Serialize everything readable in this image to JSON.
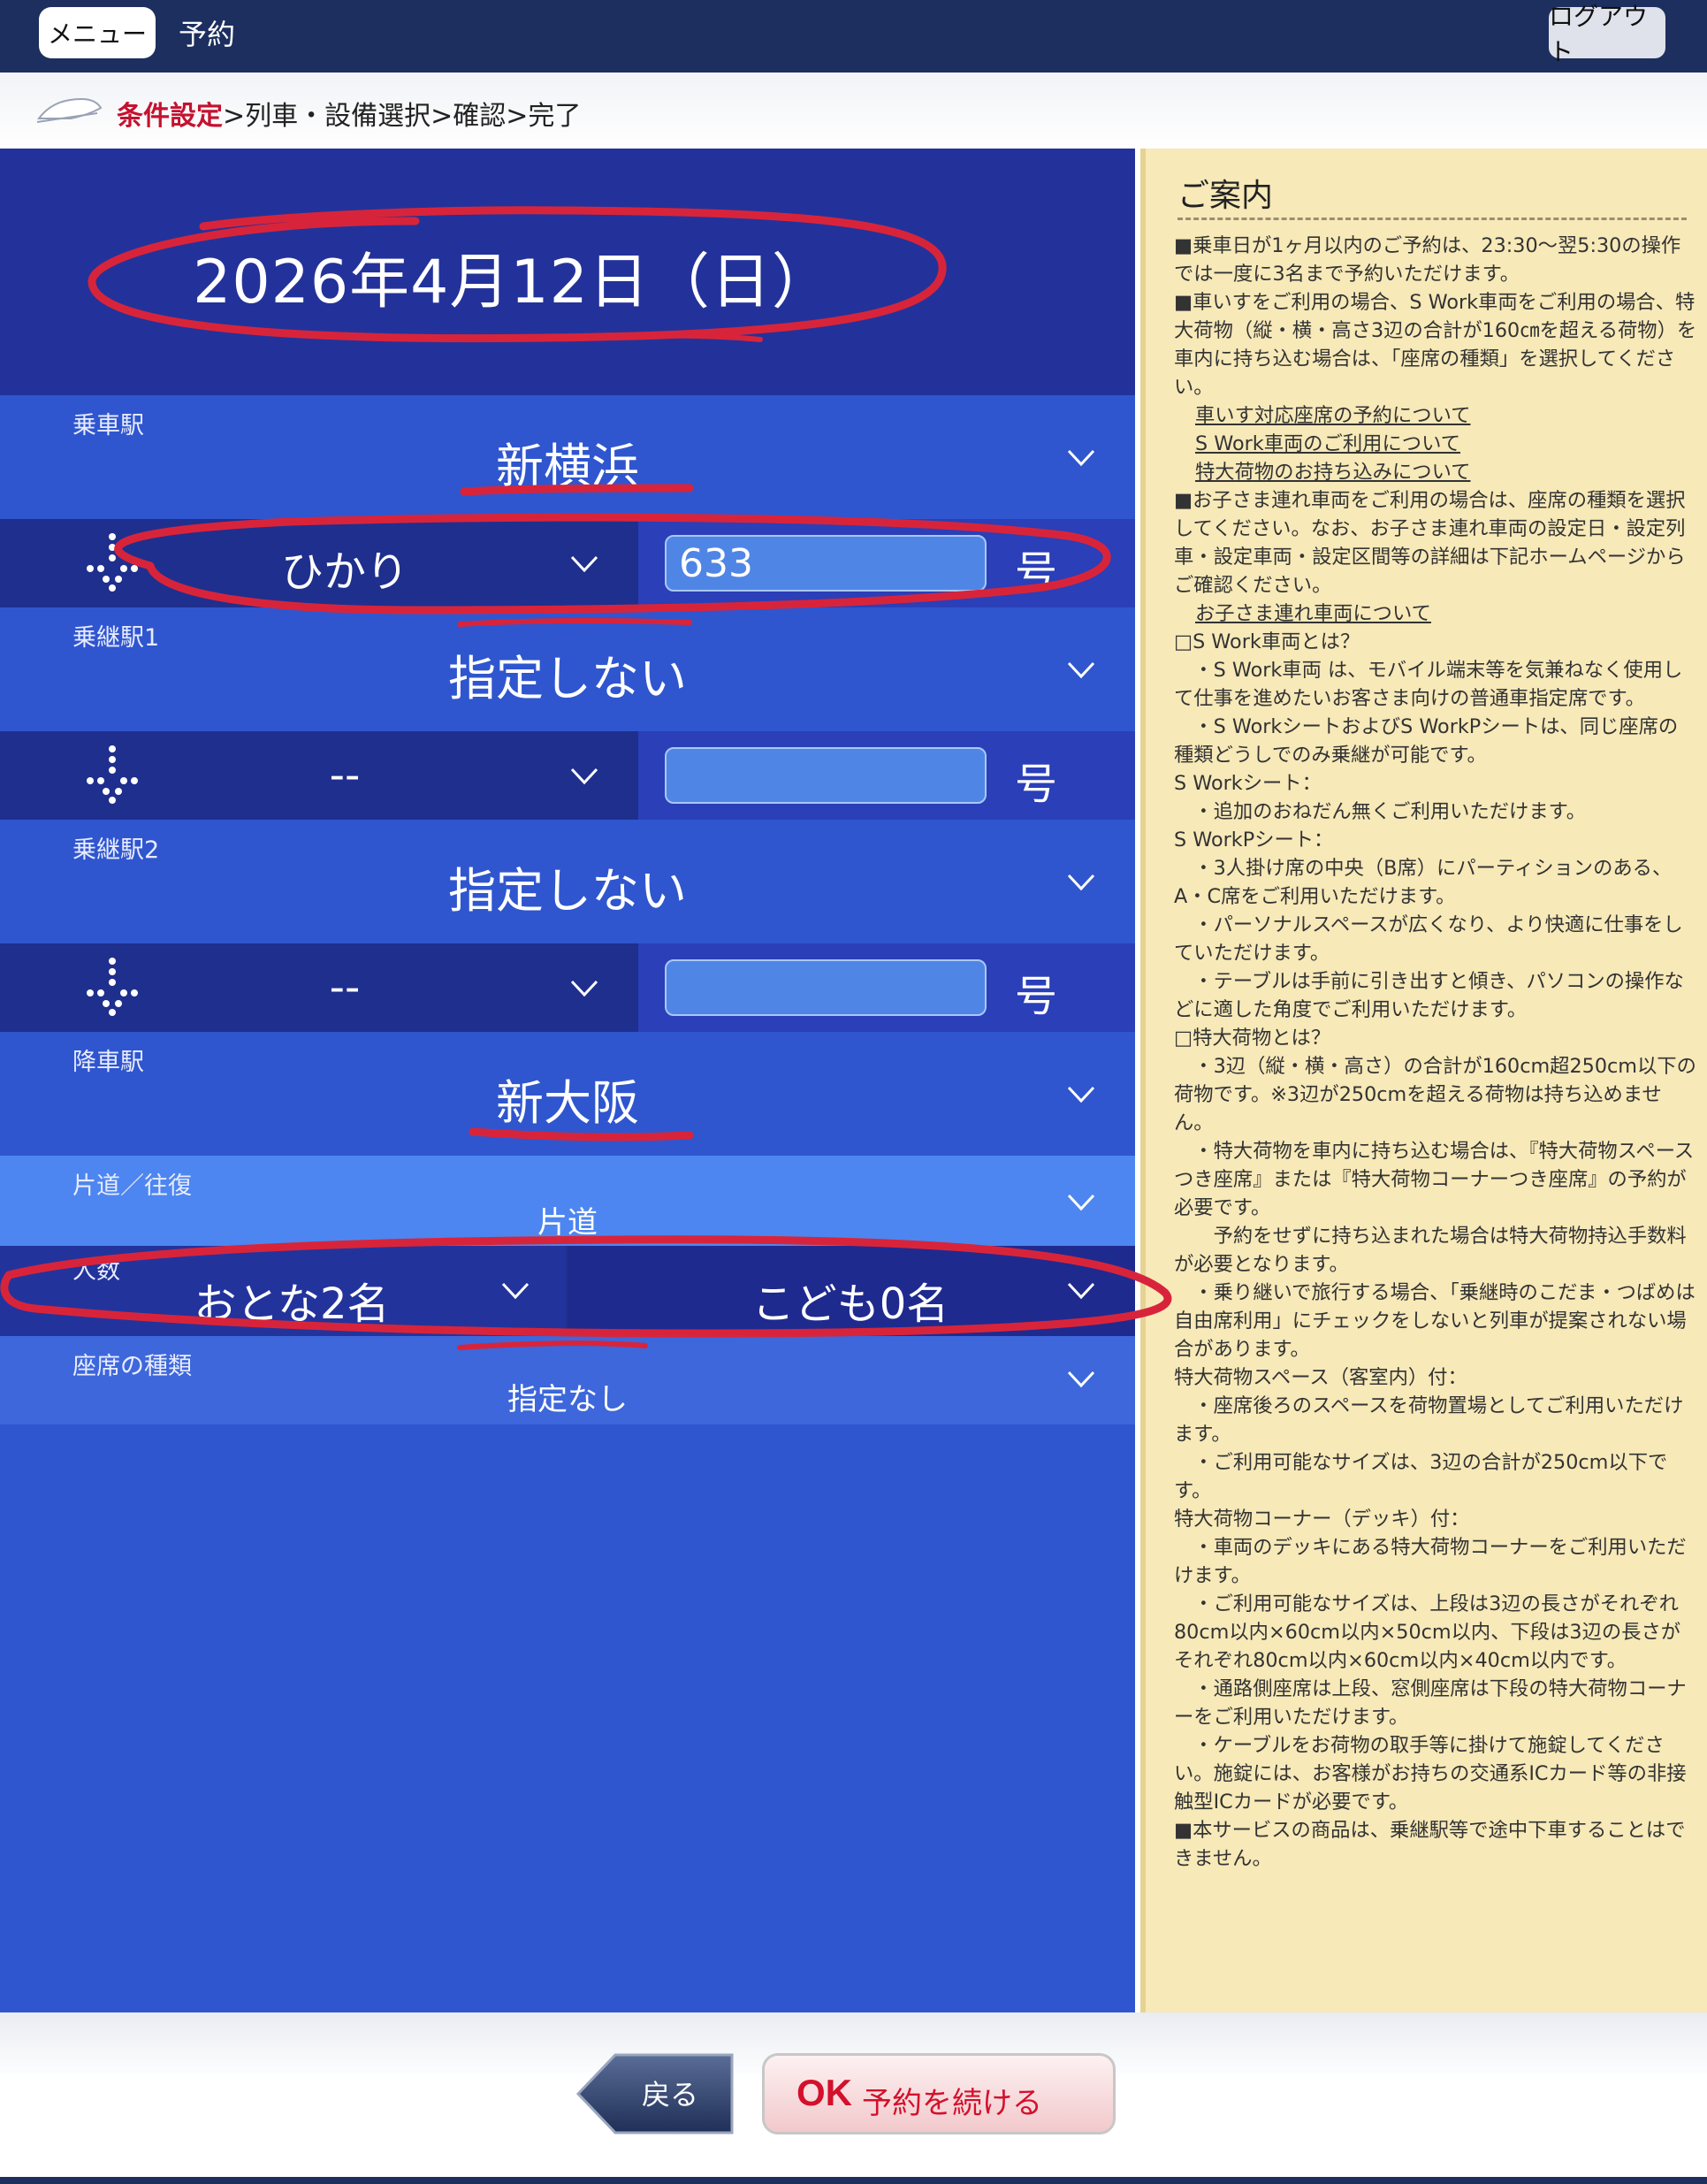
{
  "header": {
    "menu_label": "メニュー",
    "page_title": "予約",
    "logout_label": "ログアウト"
  },
  "breadcrumb": {
    "steps": [
      "条件設定",
      "列車・設備選択",
      "確認",
      "完了"
    ],
    "separator": ">",
    "active_index": 0
  },
  "form": {
    "date": "2026年4月12日（日）",
    "boarding_station": {
      "label": "乗車駅",
      "value": "新横浜"
    },
    "train1": {
      "type": "ひかり",
      "number": "633",
      "suffix": "号"
    },
    "transfer1": {
      "label": "乗継駅1",
      "value": "指定しない"
    },
    "train2": {
      "type": "--",
      "number": "",
      "suffix": "号"
    },
    "transfer2": {
      "label": "乗継駅2",
      "value": "指定しない"
    },
    "train3": {
      "type": "--",
      "number": "",
      "suffix": "号"
    },
    "arrival_station": {
      "label": "降車駅",
      "value": "新大阪"
    },
    "trip": {
      "label": "片道／往復",
      "value": "片道"
    },
    "passengers": {
      "label": "人数",
      "adult": "おとな2名",
      "child": "こども0名"
    },
    "seat_type": {
      "label": "座席の種類",
      "value": "指定なし"
    }
  },
  "info": {
    "title": "ご案内",
    "paragraphs": [
      "■乗車日が1ヶ月以内のご予約は、23:30～翌5:30の操作では一度に3名まで予約いただけます。",
      "■車いすをご利用の場合、S Work車両をご利用の場合、特大荷物（縦・横・高さ3辺の合計が160㎝を超える荷物）を車内に持ち込む場合は、「座席の種類」を選択してください。",
      "車いす対応座席の予約について",
      "S Work車両のご利用について",
      "特大荷物のお持ち込みについて",
      "■お子さま連れ車両をご利用の場合は、座席の種類を選択してください。なお、お子さま連れ車両の設定日・設定列車・設定車両・設定区間等の詳細は下記ホームページからご確認ください。",
      "お子さま連れ車両について",
      "□S Work車両とは？",
      "　・S Work車両 は、モバイル端末等を気兼ねなく使用して仕事を進めたいお客さま向けの普通車指定席です。",
      "　・S WorkシートおよびS WorkPシートは、同じ座席の種類どうしでのみ乗継が可能です。",
      "S Workシート：",
      "　・追加のおねだん無くご利用いただけます。",
      "S WorkPシート：",
      "　・3人掛け席の中央（B席）にパーティションのある、A・C席をご利用いただけます。",
      "　・パーソナルスペースが広くなり、より快適に仕事をしていただけます。",
      "　・テーブルは手前に引き出すと傾き、パソコンの操作などに適した角度でご利用いただけます。",
      "□特大荷物とは？",
      "　・3辺（縦・横・高さ）の合計が160cm超250cm以下の荷物です。※3辺が250cmを超える荷物は持ち込めません。",
      "　・特大荷物を車内に持ち込む場合は、『特大荷物スペースつき座席』または『特大荷物コーナーつき座席』の予約が必要です。",
      "　　予約をせずに持ち込まれた場合は特大荷物持込手数料が必要となります。",
      "　・乗り継いで旅行する場合、「乗継時のこだま・つばめは自由席利用」にチェックをしないと列車が提案されない場合があります。",
      "特大荷物スペース（客室内）付：",
      "　・座席後ろのスペースを荷物置場としてご利用いただけます。",
      "　・ご利用可能なサイズは、3辺の合計が250cm以下です。",
      "特大荷物コーナー（デッキ）付：",
      "　・車両のデッキにある特大荷物コーナーをご利用いただけます。",
      "　・ご利用可能なサイズは、上段は3辺の長さがそれぞれ80cm以内×60cm以内×50cm以内、下段は3辺の長さがそれぞれ80cm以内×60cm以内×40cm以内です。",
      "　・通路側座席は上段、窓側座席は下段の特大荷物コーナーをご利用いただけます。",
      "　・ケーブルをお荷物の取手等に掛けて施錠してください。施錠には、お客様がお持ちの交通系ICカード等の非接触型ICカードが必要です。",
      "■本サービスの商品は、乗継駅等で途中下車することはできません。"
    ]
  },
  "footer": {
    "back_label": "戻る",
    "ok_mark": "OK",
    "ok_label": "予約を続ける"
  },
  "colors": {
    "header_bg": "#1d2f5e",
    "form_bg": "#2f56cf",
    "date_bg": "#23329a",
    "info_bg": "#f7e9b8",
    "accent_red": "#d4102c"
  }
}
